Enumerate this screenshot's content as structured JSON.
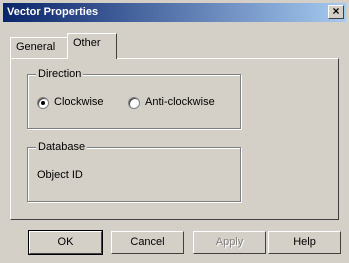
{
  "window": {
    "title": "Vector Properties",
    "close_glyph": "×"
  },
  "tabs": [
    {
      "label": "General",
      "selected": false
    },
    {
      "label": "Other",
      "selected": true
    }
  ],
  "direction": {
    "label": "Direction",
    "options": [
      {
        "label": "Clockwise",
        "selected": true
      },
      {
        "label": "Anti-clockwise",
        "selected": false
      }
    ]
  },
  "database": {
    "label": "Database",
    "object_id_label": "Object ID"
  },
  "buttons": {
    "ok": "OK",
    "cancel": "Cancel",
    "apply": "Apply",
    "help": "Help"
  },
  "colors": {
    "dialog_bg": "#d4d0c8",
    "titlebar_start": "#0a246a",
    "titlebar_end": "#a6caf0"
  }
}
